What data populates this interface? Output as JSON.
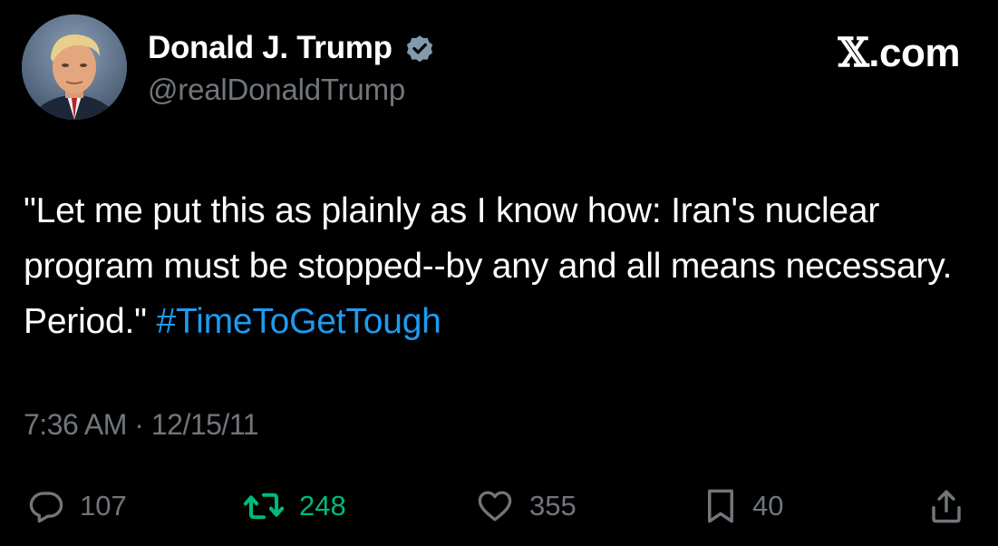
{
  "user": {
    "display_name": "Donald J. Trump",
    "handle": "@realDonaldTrump",
    "verified": true,
    "avatar_icon": "profile-photo"
  },
  "brand": {
    "x_glyph": "𝕏",
    "domain": ".com"
  },
  "tweet": {
    "text": "\"Let me put this as plainly as I know how: Iran's nuclear program must be stopped--by any and all means necessary. Period.\" ",
    "hashtag": "#TimeToGetTough",
    "time": "7:36 AM",
    "separator": " · ",
    "date": "12/15/11"
  },
  "actions": {
    "replies": "107",
    "reposts": "248",
    "likes": "355",
    "bookmarks": "40"
  },
  "colors": {
    "background": "#000000",
    "text": "#ffffff",
    "muted": "#71767b",
    "link": "#1d9bf0",
    "repost_active": "#00ba7c",
    "verified_badge": "#829aab"
  },
  "icons": {
    "reply": "reply-icon",
    "repost": "repost-icon",
    "like": "heart-icon",
    "bookmark": "bookmark-icon",
    "share": "share-icon",
    "verified": "verified-badge-icon"
  }
}
